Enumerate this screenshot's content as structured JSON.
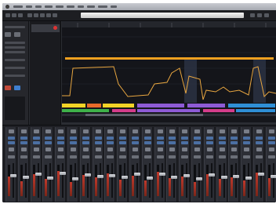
{
  "app": {
    "window_title": "",
    "clock": ""
  },
  "transport": {
    "label": ""
  },
  "track_list": {
    "first_track_name": ""
  },
  "automation": {
    "curve_color": "#e8a640",
    "note_bar_color": "#f0a020",
    "region_colors": [
      "#f2d326",
      "#8e5bd6",
      "#3fb24a",
      "#d43d8b",
      "#2f8fd6",
      "#e86a2a"
    ]
  },
  "mixer": {
    "channel_count": 22,
    "meter_levels": [
      0.62,
      0.48,
      0.71,
      0.55,
      0.8,
      0.44,
      0.67,
      0.59,
      0.73,
      0.52,
      0.66,
      0.49,
      0.77,
      0.58,
      0.63,
      0.45,
      0.7,
      0.54,
      0.61,
      0.5,
      0.74,
      0.57
    ],
    "fader_levels": [
      0.65,
      0.6,
      0.7,
      0.58,
      0.72,
      0.55,
      0.68,
      0.62,
      0.66,
      0.59,
      0.71,
      0.57,
      0.69,
      0.61,
      0.64,
      0.56,
      0.67,
      0.6,
      0.63,
      0.58,
      0.7,
      0.62
    ],
    "button_color": "#4b6fa3",
    "meter_color": "#c0392b"
  }
}
